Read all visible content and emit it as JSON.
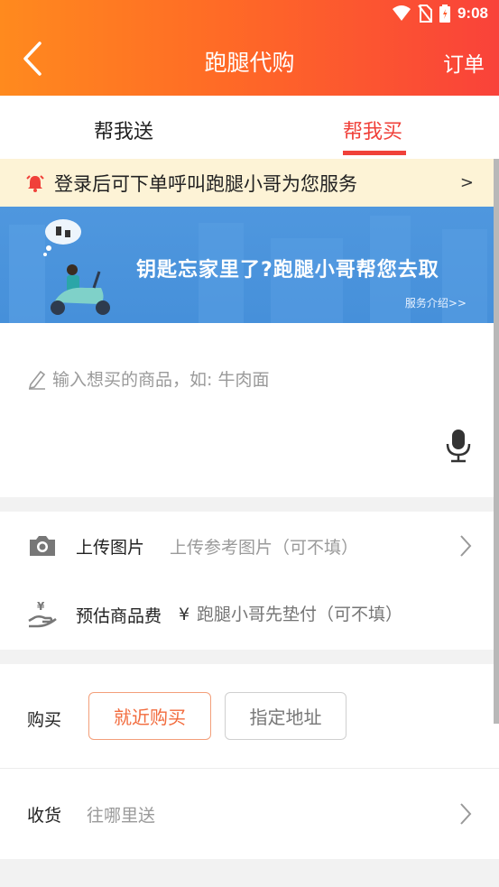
{
  "status_bar": {
    "time": "9:08"
  },
  "header": {
    "title": "跑腿代购",
    "orders_label": "订单"
  },
  "tabs": [
    {
      "label": "帮我送",
      "active": false
    },
    {
      "label": "帮我买",
      "active": true
    }
  ],
  "notice": {
    "text": "登录后可下单呼叫跑腿小哥为您服务",
    "arrow": ">"
  },
  "banner": {
    "title": "钥匙忘家里了?跑腿小哥帮您去取",
    "link": "服务介绍>>"
  },
  "item_input": {
    "placeholder": "输入想买的商品，如: 牛肉面"
  },
  "upload": {
    "label": "上传图片",
    "hint": "上传参考图片（可不填）"
  },
  "fee": {
    "label": "预估商品费",
    "currency": "¥",
    "hint": "跑腿小哥先垫付（可不填）"
  },
  "purchase": {
    "label": "购买",
    "option_nearby": "就近购买",
    "option_address": "指定地址"
  },
  "delivery": {
    "label": "收货",
    "placeholder": "往哪里送"
  },
  "colors": {
    "brand_orange": "#ff8a1e",
    "brand_red": "#f0413a",
    "banner_blue": "#4a93dc",
    "notice_bg": "#fdf3d6"
  }
}
